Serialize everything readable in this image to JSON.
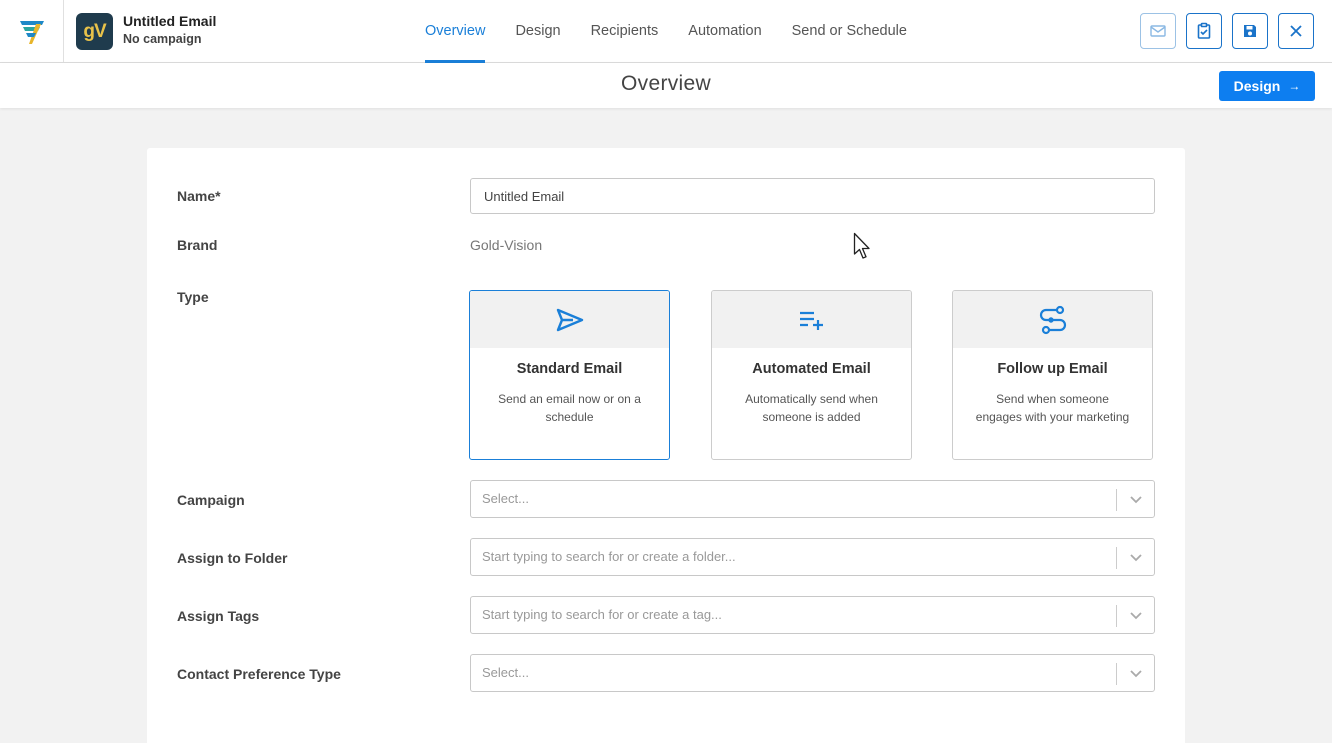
{
  "header": {
    "title": "Untitled Email",
    "subtitle": "No campaign",
    "avatar_text": "gV",
    "tabs": [
      {
        "label": "Overview",
        "active": true
      },
      {
        "label": "Design",
        "active": false
      },
      {
        "label": "Recipients",
        "active": false
      },
      {
        "label": "Automation",
        "active": false
      },
      {
        "label": "Send or Schedule",
        "active": false
      }
    ],
    "icons": [
      "mail-preview-icon",
      "clipboard-check-icon",
      "save-icon",
      "close-icon"
    ]
  },
  "subheader": {
    "title": "Overview",
    "design_button": "Design",
    "design_arrow": "→"
  },
  "form": {
    "name_label": "Name*",
    "name_value": "Untitled Email",
    "brand_label": "Brand",
    "brand_value": "Gold-Vision",
    "type_label": "Type",
    "types": [
      {
        "title": "Standard Email",
        "desc": "Send an email now or on a schedule",
        "icon": "send-icon",
        "selected": true
      },
      {
        "title": "Automated Email",
        "desc": "Automatically send when someone is added",
        "icon": "playlist-add-icon",
        "selected": false
      },
      {
        "title": "Follow up Email",
        "desc": "Send when someone engages with your marketing",
        "icon": "route-icon",
        "selected": false
      }
    ],
    "campaign_label": "Campaign",
    "campaign_placeholder": "Select...",
    "folder_label": "Assign to Folder",
    "folder_placeholder": "Start typing to search for or create a folder...",
    "tags_label": "Assign Tags",
    "tags_placeholder": "Start typing to search for or create a tag...",
    "preference_label": "Contact Preference Type",
    "preference_placeholder": "Select..."
  },
  "colors": {
    "accent": "#1a7fd8",
    "primary_button": "#0d7ef0",
    "background": "#f2f2f2"
  }
}
